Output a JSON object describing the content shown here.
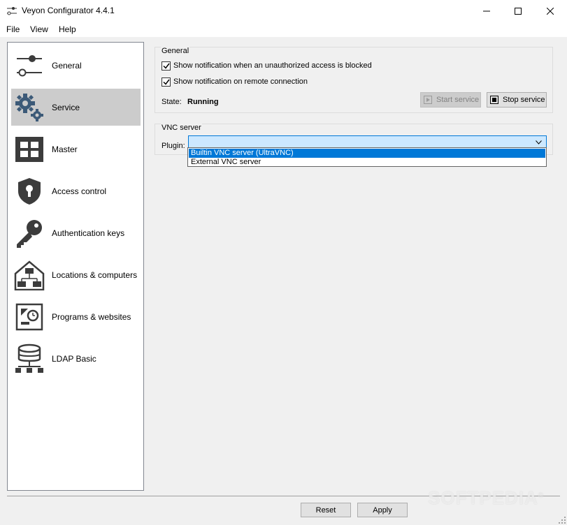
{
  "window": {
    "title": "Veyon Configurator 4.4.1"
  },
  "menu": [
    "File",
    "View",
    "Help"
  ],
  "sidebar": {
    "items": [
      {
        "label": "General",
        "icon": "sliders-icon"
      },
      {
        "label": "Service",
        "icon": "gears-icon",
        "selected": true
      },
      {
        "label": "Master",
        "icon": "grid-icon"
      },
      {
        "label": "Access control",
        "icon": "shield-keyhole-icon"
      },
      {
        "label": "Authentication keys",
        "icon": "key-icon"
      },
      {
        "label": "Locations & computers",
        "icon": "house-network-icon"
      },
      {
        "label": "Programs & websites",
        "icon": "programs-icon"
      },
      {
        "label": "LDAP Basic",
        "icon": "database-icon"
      }
    ]
  },
  "general": {
    "title": "General",
    "checkbox_unauthorized": {
      "label": "Show notification when an unauthorized access is blocked",
      "checked": true
    },
    "checkbox_remote": {
      "label": "Show notification on remote connection",
      "checked": true
    },
    "state_label": "State:",
    "state_value": "Running",
    "start_service": "Start service",
    "stop_service": "Stop service"
  },
  "vnc": {
    "title": "VNC server",
    "plugin_label": "Plugin:",
    "plugin_value": "",
    "options": [
      "Builtin VNC server (UltraVNC)",
      "External VNC server"
    ],
    "highlighted_option": "Builtin VNC server (UltraVNC)"
  },
  "footer": {
    "reset": "Reset",
    "apply": "Apply"
  },
  "watermark": "SOFTPEDIA",
  "watermark_mark": "®",
  "colors": {
    "accent": "#0078d7",
    "selection_bg": "#cccccc",
    "icon": "#3c3c3c"
  }
}
